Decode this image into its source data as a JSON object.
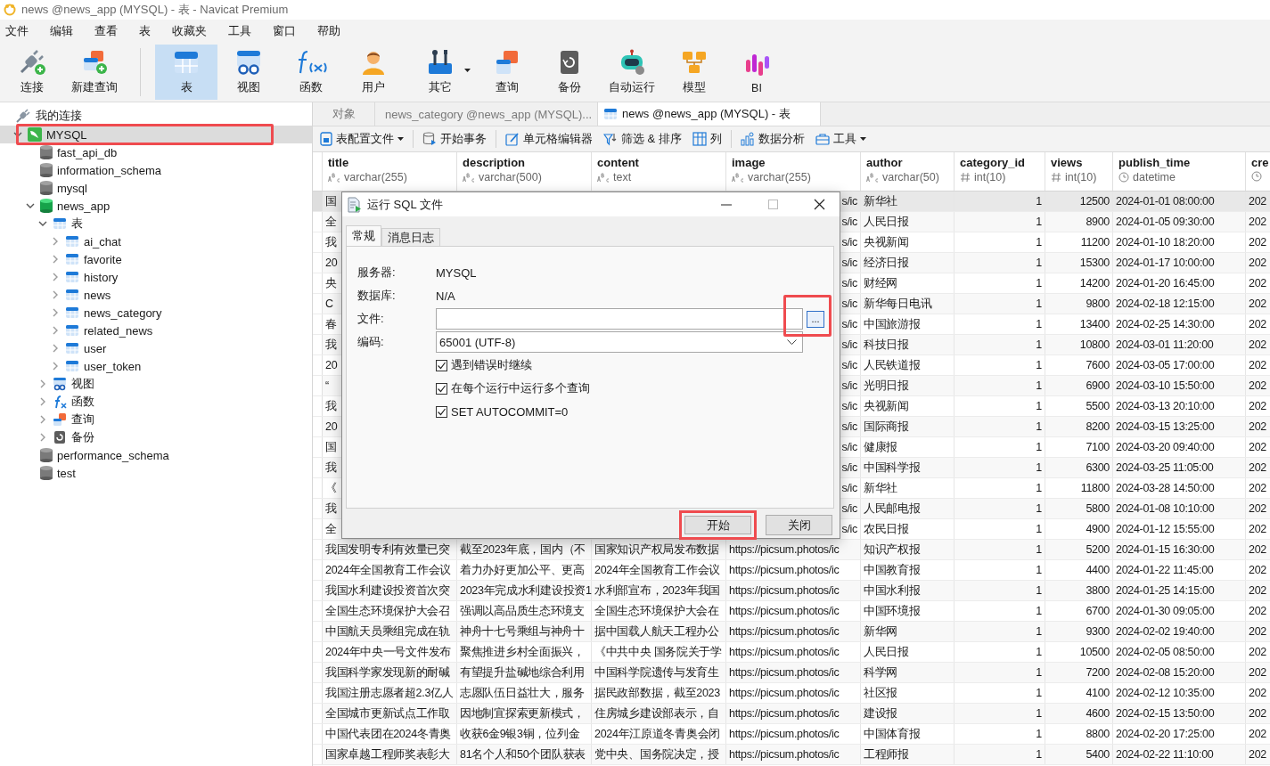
{
  "window": {
    "title": "news @news_app (MYSQL) - 表 - Navicat Premium"
  },
  "menu": [
    "文件",
    "编辑",
    "查看",
    "表",
    "收藏夹",
    "工具",
    "窗口",
    "帮助"
  ],
  "toolbar": [
    [
      {
        "label": "连接",
        "selected": false
      },
      {
        "label": "新建查询",
        "selected": false
      }
    ],
    [
      {
        "label": "表",
        "selected": true
      },
      {
        "label": "视图",
        "selected": false
      },
      {
        "label": "函数",
        "selected": false
      },
      {
        "label": "用户",
        "selected": false
      },
      {
        "label": "其它",
        "selected": false,
        "dropdown": true
      },
      {
        "label": "查询",
        "selected": false
      },
      {
        "label": "备份",
        "selected": false
      },
      {
        "label": "自动运行",
        "selected": false
      },
      {
        "label": "模型",
        "selected": false
      },
      {
        "label": "BI",
        "selected": false
      }
    ]
  ],
  "sidebar": {
    "header": "我的连接",
    "tree": [
      {
        "label": "MYSQL",
        "kind": "connection",
        "expanded": true,
        "selected": true,
        "annotated": true,
        "children": [
          {
            "label": "fast_api_db",
            "kind": "database",
            "selected": false
          },
          {
            "label": "information_schema",
            "kind": "database",
            "selected": false
          },
          {
            "label": "mysql",
            "kind": "database",
            "selected": false
          },
          {
            "label": "news_app",
            "kind": "database",
            "expanded": true,
            "selected": false,
            "children": [
              {
                "label": "表",
                "kind": "tables",
                "expanded": true,
                "selected": false,
                "children": [
                  {
                    "label": "ai_chat",
                    "kind": "table",
                    "expanded": false,
                    "selected": false
                  },
                  {
                    "label": "favorite",
                    "kind": "table",
                    "expanded": false,
                    "selected": false
                  },
                  {
                    "label": "history",
                    "kind": "table",
                    "expanded": false,
                    "selected": false
                  },
                  {
                    "label": "news",
                    "kind": "table",
                    "expanded": false,
                    "selected": false
                  },
                  {
                    "label": "news_category",
                    "kind": "table",
                    "expanded": false,
                    "selected": false
                  },
                  {
                    "label": "related_news",
                    "kind": "table",
                    "expanded": false,
                    "selected": false
                  },
                  {
                    "label": "user",
                    "kind": "table",
                    "expanded": false,
                    "selected": false
                  },
                  {
                    "label": "user_token",
                    "kind": "table",
                    "expanded": false,
                    "selected": false
                  }
                ]
              },
              {
                "label": "视图",
                "kind": "views",
                "expanded": false,
                "selected": false
              },
              {
                "label": "函数",
                "kind": "functions",
                "expanded": false,
                "selected": false
              },
              {
                "label": "查询",
                "kind": "queries",
                "expanded": false,
                "selected": false
              },
              {
                "label": "备份",
                "kind": "backups",
                "expanded": false,
                "selected": false
              }
            ]
          },
          {
            "label": "performance_schema",
            "kind": "database",
            "selected": false
          },
          {
            "label": "test",
            "kind": "database",
            "selected": false
          }
        ]
      }
    ]
  },
  "tabs": [
    {
      "label": "对象",
      "kind": "plain",
      "selected": false
    },
    {
      "label": "news_category @news_app (MYSQL)...",
      "kind": "table",
      "selected": false
    },
    {
      "label": "news @news_app (MYSQL) - 表",
      "kind": "table",
      "selected": true
    }
  ],
  "table_toolbar": [
    [
      {
        "label": "表配置文件",
        "dropdown": true
      }
    ],
    [
      {
        "label": "开始事务"
      }
    ],
    [
      {
        "label": "单元格编辑器"
      },
      {
        "label": "筛选 & 排序"
      },
      {
        "label": "列"
      }
    ],
    [
      {
        "label": "数据分析"
      },
      {
        "label": "工具",
        "dropdown": true
      }
    ]
  ],
  "table": {
    "columns": [
      {
        "name": "title",
        "type": "varchar(255)",
        "kind": "text"
      },
      {
        "name": "description",
        "type": "varchar(500)",
        "kind": "text"
      },
      {
        "name": "content",
        "type": "text",
        "kind": "text"
      },
      {
        "name": "image",
        "type": "varchar(255)",
        "kind": "text"
      },
      {
        "name": "author",
        "type": "varchar(50)",
        "kind": "text"
      },
      {
        "name": "category_id",
        "type": "int(10)",
        "kind": "number"
      },
      {
        "name": "views",
        "type": "int(10)",
        "kind": "number"
      },
      {
        "name": "publish_time",
        "type": "datetime",
        "kind": "datetime"
      },
      {
        "name": "cre",
        "kind": "datetime"
      }
    ],
    "rows": [
      {
        "selected": true,
        "covered": true,
        "cells": [
          "国",
          null,
          null,
          "s/ic",
          "新华社",
          "1",
          "12500",
          "2024-01-01 08:00:00",
          "202"
        ]
      },
      {
        "selected": false,
        "covered": true,
        "cells": [
          "全",
          null,
          null,
          "s/ic",
          "人民日报",
          "1",
          "8900",
          "2024-01-05 09:30:00",
          "202"
        ]
      },
      {
        "selected": false,
        "covered": true,
        "cells": [
          "我",
          null,
          null,
          "s/ic",
          "央视新闻",
          "1",
          "11200",
          "2024-01-10 18:20:00",
          "202"
        ]
      },
      {
        "selected": false,
        "covered": true,
        "cells": [
          "20",
          null,
          null,
          "s/ic",
          "经济日报",
          "1",
          "15300",
          "2024-01-17 10:00:00",
          "202"
        ]
      },
      {
        "selected": false,
        "covered": true,
        "cells": [
          "央",
          null,
          null,
          "s/ic",
          "财经网",
          "1",
          "14200",
          "2024-01-20 16:45:00",
          "202"
        ]
      },
      {
        "selected": false,
        "covered": true,
        "cells": [
          "C",
          null,
          null,
          "s/ic",
          "新华每日电讯",
          "1",
          "9800",
          "2024-02-18 12:15:00",
          "202"
        ]
      },
      {
        "selected": false,
        "covered": true,
        "cells": [
          "春",
          null,
          null,
          "s/ic",
          "中国旅游报",
          "1",
          "13400",
          "2024-02-25 14:30:00",
          "202"
        ]
      },
      {
        "selected": false,
        "covered": true,
        "cells": [
          "我",
          null,
          null,
          "s/ic",
          "科技日报",
          "1",
          "10800",
          "2024-03-01 11:20:00",
          "202"
        ]
      },
      {
        "selected": false,
        "covered": true,
        "cells": [
          "20",
          null,
          null,
          "s/ic",
          "人民铁道报",
          "1",
          "7600",
          "2024-03-05 17:00:00",
          "202"
        ]
      },
      {
        "selected": false,
        "covered": true,
        "cells": [
          "“",
          null,
          null,
          "s/ic",
          "光明日报",
          "1",
          "6900",
          "2024-03-10 15:50:00",
          "202"
        ]
      },
      {
        "selected": false,
        "covered": true,
        "cells": [
          "我",
          null,
          null,
          "s/ic",
          "央视新闻",
          "1",
          "5500",
          "2024-03-13 20:10:00",
          "202"
        ]
      },
      {
        "selected": false,
        "covered": true,
        "cells": [
          "20",
          null,
          null,
          "s/ic",
          "国际商报",
          "1",
          "8200",
          "2024-03-15 13:25:00",
          "202"
        ]
      },
      {
        "selected": false,
        "covered": true,
        "cells": [
          "国",
          null,
          null,
          "s/ic",
          "健康报",
          "1",
          "7100",
          "2024-03-20 09:40:00",
          "202"
        ]
      },
      {
        "selected": false,
        "covered": true,
        "cells": [
          "我",
          null,
          null,
          "s/ic",
          "中国科学报",
          "1",
          "6300",
          "2024-03-25 11:05:00",
          "202"
        ]
      },
      {
        "selected": false,
        "covered": true,
        "cells": [
          "《",
          null,
          null,
          "s/ic",
          "新华社",
          "1",
          "11800",
          "2024-03-28 14:50:00",
          "202"
        ]
      },
      {
        "selected": false,
        "covered": true,
        "cells": [
          "我",
          null,
          null,
          "s/ic",
          "人民邮电报",
          "1",
          "5800",
          "2024-01-08 10:10:00",
          "202"
        ]
      },
      {
        "selected": false,
        "covered": true,
        "cells": [
          "全",
          null,
          null,
          "s/ic",
          "农民日报",
          "1",
          "4900",
          "2024-01-12 15:55:00",
          "202"
        ]
      },
      {
        "selected": false,
        "covered": false,
        "cells": [
          "我国发明专利有效量已突",
          "截至2023年底，国内（不",
          "国家知识产权局发布数据",
          "https://picsum.photos/ic",
          "知识产权报",
          "1",
          "5200",
          "2024-01-15 16:30:00",
          "202"
        ]
      },
      {
        "selected": false,
        "covered": false,
        "cells": [
          "2024年全国教育工作会议",
          "着力办好更加公平、更高",
          "2024年全国教育工作会议",
          "https://picsum.photos/ic",
          "中国教育报",
          "1",
          "4400",
          "2024-01-22 11:45:00",
          "202"
        ]
      },
      {
        "selected": false,
        "covered": false,
        "cells": [
          "我国水利建设投资首次突",
          "2023年完成水利建设投资1",
          "水利部宣布，2023年我国",
          "https://picsum.photos/ic",
          "中国水利报",
          "1",
          "3800",
          "2024-01-25 14:15:00",
          "202"
        ]
      },
      {
        "selected": false,
        "covered": false,
        "cells": [
          "全国生态环境保护大会召",
          "强调以高品质生态环境支",
          "全国生态环境保护大会在",
          "https://picsum.photos/ic",
          "中国环境报",
          "1",
          "6700",
          "2024-01-30 09:05:00",
          "202"
        ]
      },
      {
        "selected": false,
        "covered": false,
        "cells": [
          "中国航天员乘组完成在轨",
          "神舟十七号乘组与神舟十",
          "据中国载人航天工程办公",
          "https://picsum.photos/ic",
          "新华网",
          "1",
          "9300",
          "2024-02-02 19:40:00",
          "202"
        ]
      },
      {
        "selected": false,
        "covered": false,
        "cells": [
          "2024年中央一号文件发布",
          "聚焦推进乡村全面振兴，",
          "《中共中央 国务院关于学",
          "https://picsum.photos/ic",
          "人民日报",
          "1",
          "10500",
          "2024-02-05 08:50:00",
          "202"
        ]
      },
      {
        "selected": false,
        "covered": false,
        "cells": [
          "我国科学家发现新的耐碱",
          "有望提升盐碱地综合利用",
          "中国科学院遗传与发育生",
          "https://picsum.photos/ic",
          "科学网",
          "1",
          "7200",
          "2024-02-08 15:20:00",
          "202"
        ]
      },
      {
        "selected": false,
        "covered": false,
        "cells": [
          "我国注册志愿者超2.3亿人",
          "志愿队伍日益壮大，服务",
          "据民政部数据，截至2023",
          "https://picsum.photos/ic",
          "社区报",
          "1",
          "4100",
          "2024-02-12 10:35:00",
          "202"
        ]
      },
      {
        "selected": false,
        "covered": false,
        "cells": [
          "全国城市更新试点工作取",
          "因地制宜探索更新模式，",
          "住房城乡建设部表示，自",
          "https://picsum.photos/ic",
          "建设报",
          "1",
          "4600",
          "2024-02-15 13:50:00",
          "202"
        ]
      },
      {
        "selected": false,
        "covered": false,
        "cells": [
          "中国代表团在2024冬青奥",
          "收获6金9银3铜，位列金",
          "2024年江原道冬青奥会闭",
          "https://picsum.photos/ic",
          "中国体育报",
          "1",
          "8800",
          "2024-02-20 17:25:00",
          "202"
        ]
      },
      {
        "selected": false,
        "covered": false,
        "cells": [
          "国家卓越工程师奖表彰大",
          "81名个人和50个团队获表",
          "党中央、国务院决定，授",
          "https://picsum.photos/ic",
          "工程师报",
          "1",
          "5400",
          "2024-02-22 11:10:00",
          "202"
        ]
      }
    ]
  },
  "dialog": {
    "title": "运行 SQL 文件",
    "tabs": [
      {
        "label": "常规",
        "selected": true
      },
      {
        "label": "消息日志",
        "selected": false
      }
    ],
    "fields": [
      {
        "label": "服务器:",
        "kind": "info",
        "value": "MYSQL"
      },
      {
        "label": "数据库:",
        "kind": "info",
        "value": "N/A"
      },
      {
        "label": "文件:",
        "kind": "file",
        "browse": "...",
        "annotated": true
      },
      {
        "label": "编码:",
        "kind": "select",
        "value": "65001 (UTF-8)"
      }
    ],
    "options": [
      {
        "label": "遇到错误时继续",
        "checked": true
      },
      {
        "label": "在每个运行中运行多个查询",
        "checked": true
      },
      {
        "label": "SET AUTOCOMMIT=0",
        "checked": true
      }
    ],
    "buttons": [
      {
        "label": "开始",
        "annotated": true
      },
      {
        "label": "关闭",
        "annotated": false
      }
    ]
  }
}
